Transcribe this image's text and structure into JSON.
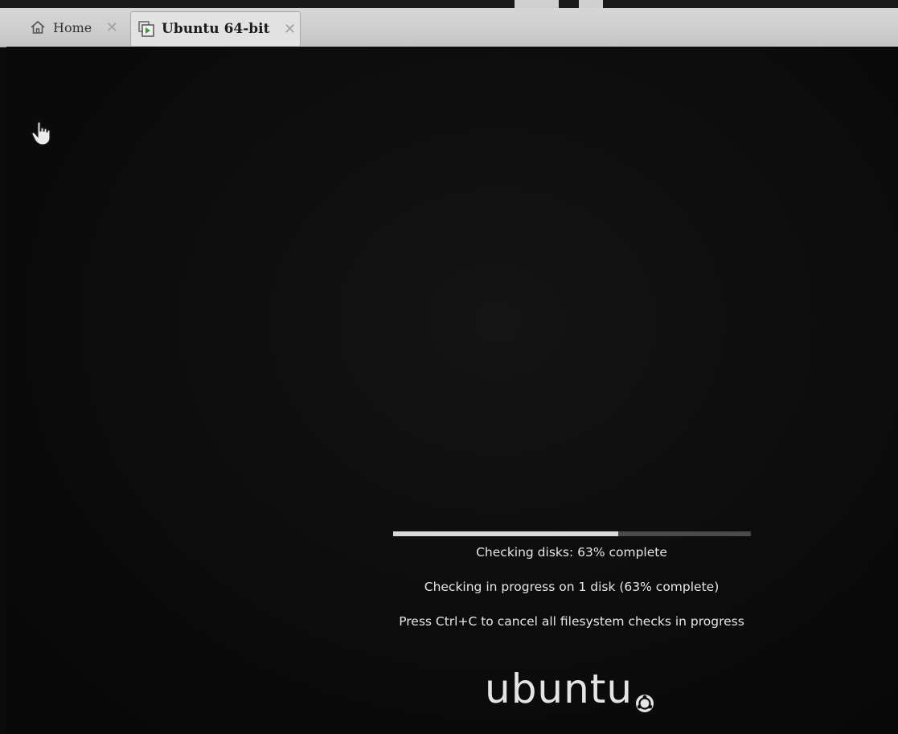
{
  "tabs": [
    {
      "label": "Home",
      "icon": "home-icon",
      "active": false,
      "close": "✕"
    },
    {
      "label": "Ubuntu 64-bit",
      "icon": "vm-icon",
      "active": true,
      "close": "✕"
    }
  ],
  "screen": {
    "progress_percent": 63,
    "status_main": "Checking disks: 63% complete",
    "status_detail": "Checking in progress on 1 disk (63% complete)",
    "status_hint": "Press Ctrl+C to cancel all filesystem checks in progress",
    "logo_text": "ubuntu"
  },
  "colors": {
    "screen_bg": "#0b0b0b",
    "text": "#e6e6e6",
    "progress_fill": "#d9d9d9",
    "progress_track": "#4a4a4a",
    "tabbar_bg": "#cfcfcf"
  },
  "icons": {
    "cursor": "hand-pointer-icon",
    "logo_mark": "ubuntu-circle-of-friends-icon"
  }
}
